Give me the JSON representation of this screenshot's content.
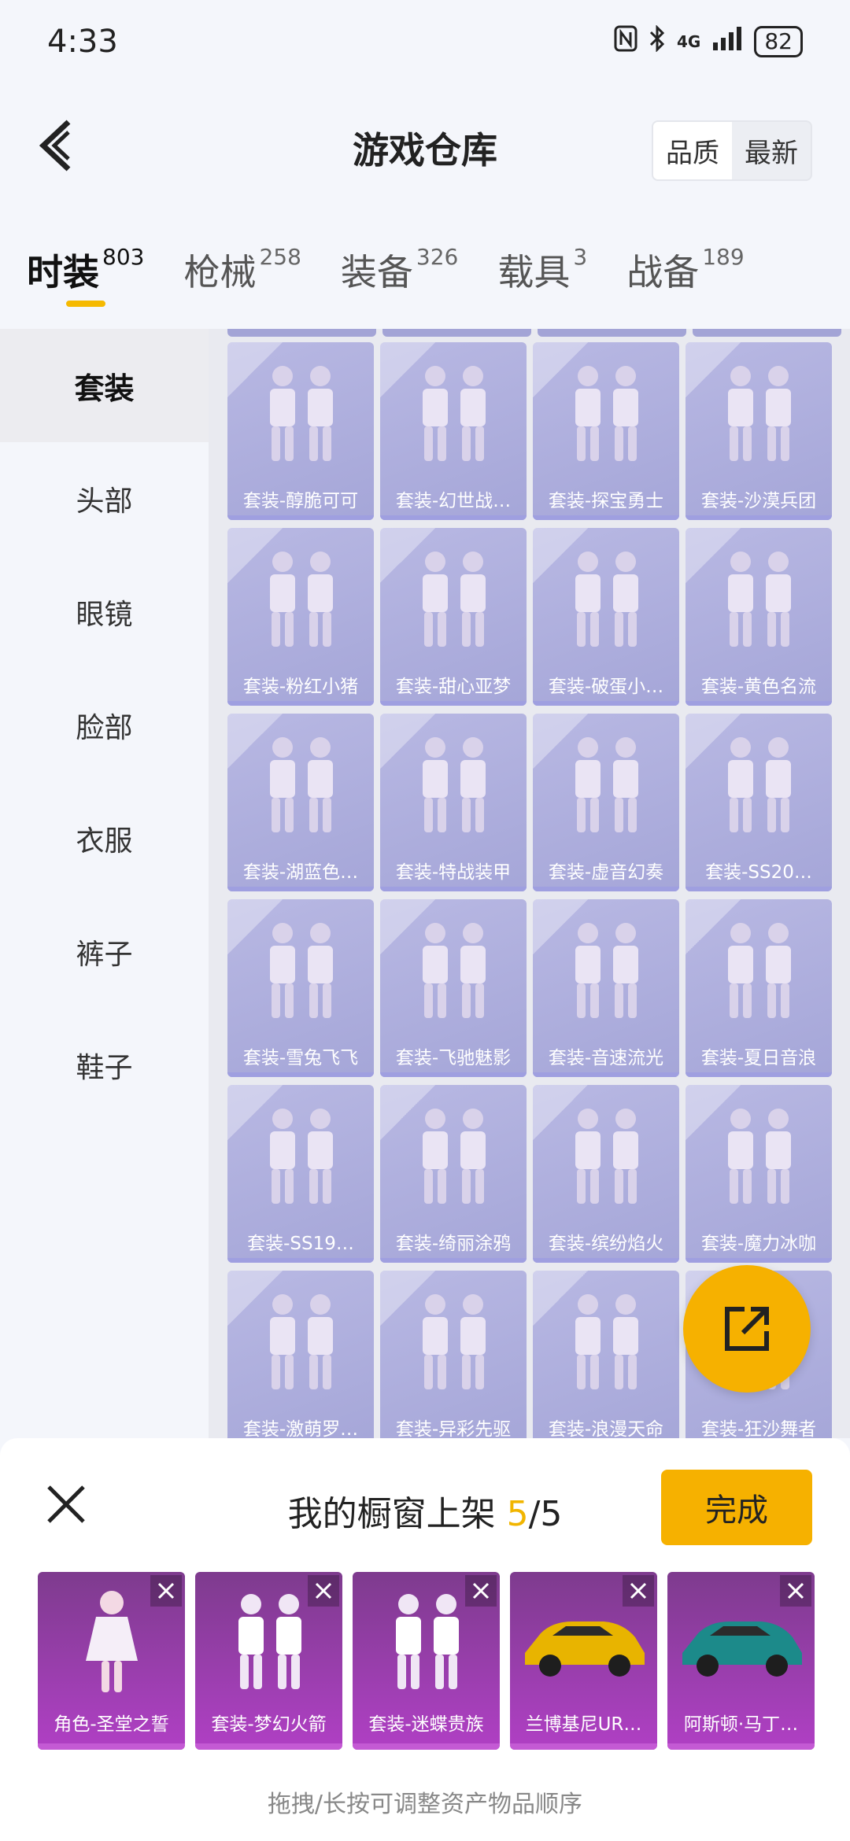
{
  "status": {
    "time": "4:33",
    "network": "4G",
    "battery": "82"
  },
  "header": {
    "title": "游戏仓库",
    "sort_options": [
      "品质",
      "最新"
    ],
    "sort_active": "品质"
  },
  "tabs": [
    {
      "label": "时装",
      "count": "803"
    },
    {
      "label": "枪械",
      "count": "258"
    },
    {
      "label": "装备",
      "count": "326"
    },
    {
      "label": "载具",
      "count": "3"
    },
    {
      "label": "战备",
      "count": "189"
    }
  ],
  "sidebar": {
    "items": [
      "套装",
      "头部",
      "眼镜",
      "脸部",
      "衣服",
      "裤子",
      "鞋子"
    ],
    "active": "套装"
  },
  "grid": {
    "items": [
      {
        "label": "套装-醇脆可可",
        "art": "outfit-icon"
      },
      {
        "label": "套装-幻世战…",
        "art": "outfit-icon"
      },
      {
        "label": "套装-探宝勇士",
        "art": "outfit-icon"
      },
      {
        "label": "套装-沙漠兵团",
        "art": "outfit-icon"
      },
      {
        "label": "套装-粉红小猪",
        "art": "outfit-icon"
      },
      {
        "label": "套装-甜心亚梦",
        "art": "outfit-icon"
      },
      {
        "label": "套装-破蛋小…",
        "art": "outfit-icon"
      },
      {
        "label": "套装-黄色名流",
        "art": "outfit-icon"
      },
      {
        "label": "套装-湖蓝色…",
        "art": "outfit-icon"
      },
      {
        "label": "套装-特战装甲",
        "art": "outfit-icon"
      },
      {
        "label": "套装-虚音幻奏",
        "art": "outfit-icon"
      },
      {
        "label": "套装-SS20…",
        "art": "outfit-icon"
      },
      {
        "label": "套装-雪兔飞飞",
        "art": "outfit-icon"
      },
      {
        "label": "套装-飞驰魅影",
        "art": "outfit-icon"
      },
      {
        "label": "套装-音速流光",
        "art": "outfit-icon"
      },
      {
        "label": "套装-夏日音浪",
        "art": "outfit-icon"
      },
      {
        "label": "套装-SS19…",
        "art": "outfit-icon"
      },
      {
        "label": "套装-绮丽涂鸦",
        "art": "outfit-icon"
      },
      {
        "label": "套装-缤纷焰火",
        "art": "outfit-icon"
      },
      {
        "label": "套装-魔力冰咖",
        "art": "outfit-icon"
      },
      {
        "label": "套装-激萌罗…",
        "art": "outfit-icon"
      },
      {
        "label": "套装-异彩先驱",
        "art": "outfit-icon"
      },
      {
        "label": "套装-浪漫天命",
        "art": "outfit-icon"
      },
      {
        "label": "套装-狂沙舞者",
        "art": "outfit-icon"
      }
    ]
  },
  "panel": {
    "title_prefix": "我的橱窗上架 ",
    "count_current": "5",
    "count_sep": "/",
    "count_total": "5",
    "done_label": "完成",
    "hint": "拖拽/长按可调整资产物品顺序",
    "selected": [
      {
        "label": "角色-圣堂之誓",
        "art": "character-icon"
      },
      {
        "label": "套装-梦幻火箭",
        "art": "outfit-icon"
      },
      {
        "label": "套装-迷蝶贵族",
        "art": "outfit-icon"
      },
      {
        "label": "兰博基尼UR…",
        "art": "car-icon"
      },
      {
        "label": "阿斯顿·马丁…",
        "art": "car-icon"
      }
    ]
  },
  "colors": {
    "accent": "#F6B100",
    "card_bg": "#A9AADA",
    "selected_bg": "#A13FB5"
  }
}
